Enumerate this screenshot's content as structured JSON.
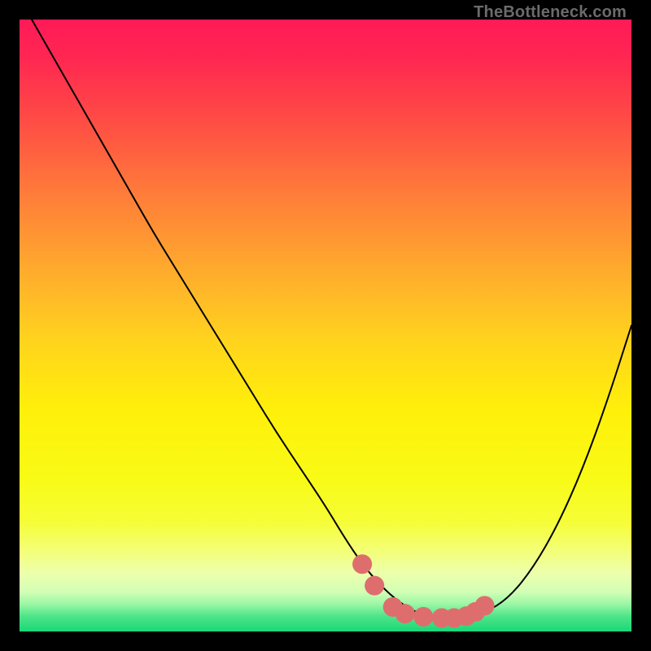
{
  "watermark": "TheBottleneck.com",
  "colors": {
    "frame": "#000000",
    "curve_line": "#000000",
    "marker_fill": "#de6e6e",
    "marker_stroke": "#de6e6e"
  },
  "chart_data": {
    "type": "line",
    "title": "",
    "xlabel": "",
    "ylabel": "",
    "xlim": [
      0,
      100
    ],
    "ylim": [
      0,
      100
    ],
    "grid": false,
    "legend": {
      "show": false
    },
    "gradient_stops": [
      {
        "offset": 0.0,
        "color": "#ff1a57"
      },
      {
        "offset": 0.06,
        "color": "#ff2652"
      },
      {
        "offset": 0.16,
        "color": "#ff4a45"
      },
      {
        "offset": 0.28,
        "color": "#ff7a3a"
      },
      {
        "offset": 0.4,
        "color": "#ffa72e"
      },
      {
        "offset": 0.52,
        "color": "#ffd21e"
      },
      {
        "offset": 0.64,
        "color": "#fff00a"
      },
      {
        "offset": 0.75,
        "color": "#f8fb16"
      },
      {
        "offset": 0.82,
        "color": "#f6fd36"
      },
      {
        "offset": 0.87,
        "color": "#f3ff7a"
      },
      {
        "offset": 0.905,
        "color": "#ecffad"
      },
      {
        "offset": 0.935,
        "color": "#d2ffb5"
      },
      {
        "offset": 0.955,
        "color": "#9cf7a6"
      },
      {
        "offset": 0.975,
        "color": "#4fe489"
      },
      {
        "offset": 1.0,
        "color": "#19d877"
      }
    ],
    "series": [
      {
        "name": "bottleneck-curve",
        "x": [
          2,
          6,
          10,
          14,
          18,
          22,
          26,
          30,
          34,
          38,
          42,
          46,
          50,
          53,
          56,
          59,
          62,
          65,
          68,
          72,
          76,
          80,
          84,
          88,
          92,
          96,
          100
        ],
        "y": [
          100,
          93,
          86,
          79,
          72,
          65,
          58.5,
          52,
          45.5,
          39,
          32.5,
          26.5,
          20.5,
          15.5,
          11,
          7.5,
          4.8,
          3.0,
          2.3,
          2.2,
          3.0,
          5.5,
          10.5,
          17.5,
          26.5,
          37.5,
          50
        ]
      }
    ],
    "markers": {
      "name": "optimum-zone",
      "points": [
        {
          "x": 56,
          "y": 11,
          "r": 1.6
        },
        {
          "x": 58,
          "y": 7.5,
          "r": 1.6
        },
        {
          "x": 61,
          "y": 4.0,
          "r": 1.6
        },
        {
          "x": 63,
          "y": 2.9,
          "r": 1.6
        },
        {
          "x": 66,
          "y": 2.4,
          "r": 1.6
        },
        {
          "x": 69,
          "y": 2.2,
          "r": 1.6
        },
        {
          "x": 71,
          "y": 2.2,
          "r": 1.6
        },
        {
          "x": 73,
          "y": 2.5,
          "r": 1.6
        },
        {
          "x": 74.5,
          "y": 3.2,
          "r": 1.6
        },
        {
          "x": 76,
          "y": 4.2,
          "r": 1.6
        }
      ]
    }
  }
}
